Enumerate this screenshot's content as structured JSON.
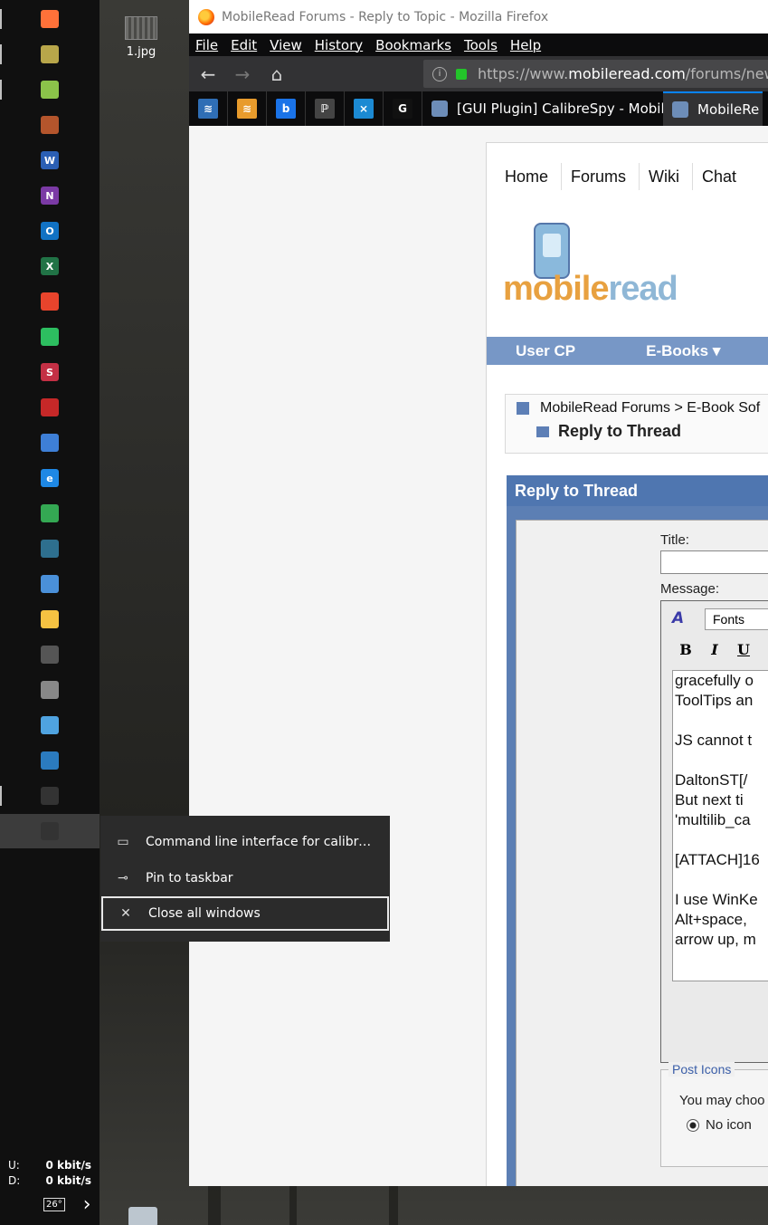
{
  "desktop": {
    "icon_label": "1.jpg"
  },
  "taskbar": {
    "apps": [
      {
        "name": "firefox",
        "color": "#ff7139"
      },
      {
        "name": "tool-app",
        "color": "#b8a64a"
      },
      {
        "name": "notes-app",
        "color": "#8bc34a"
      },
      {
        "name": "calibre-library",
        "color": "#b4552c"
      },
      {
        "name": "word",
        "letter": "W",
        "color": "#2b5fb4"
      },
      {
        "name": "onenote",
        "letter": "N",
        "color": "#7b3aa5"
      },
      {
        "name": "outlook",
        "letter": "O",
        "color": "#1172c4"
      },
      {
        "name": "excel",
        "letter": "X",
        "color": "#217346"
      },
      {
        "name": "pdf-app",
        "color": "#e8442c"
      },
      {
        "name": "evernote",
        "color": "#2dbe60"
      },
      {
        "name": "app-s",
        "letter": "S",
        "color": "#c43045"
      },
      {
        "name": "red-bug-app",
        "color": "#c62828"
      },
      {
        "name": "tool-app-2",
        "color": "#3e7fd6"
      },
      {
        "name": "edge",
        "letter": "e",
        "color": "#1e88e5"
      },
      {
        "name": "chrome",
        "color": "#34a853"
      },
      {
        "name": "editor-app",
        "color": "#2e6f8e"
      },
      {
        "name": "clipboard-app",
        "color": "#4a90d9"
      },
      {
        "name": "file-explorer",
        "color": "#f5c242"
      },
      {
        "name": "calculator",
        "color": "#555555"
      },
      {
        "name": "snip-tool",
        "color": "#888888"
      },
      {
        "name": "remote-app",
        "color": "#4fa3e0"
      },
      {
        "name": "app-blue",
        "color": "#2b7bbf"
      },
      {
        "name": "terminal",
        "color": "#333333"
      },
      {
        "name": "calibre-debug",
        "color": "#333333"
      }
    ],
    "network": {
      "up_label": "U:",
      "up_value": "0 kbit/s",
      "down_label": "D:",
      "down_value": "0 kbit/s"
    },
    "tray_temp": "26°",
    "tray_chevron": "›"
  },
  "jumplist": {
    "items": [
      {
        "label": "Command line interface for calibre d...",
        "icon": "▭"
      },
      {
        "label": "Pin to taskbar",
        "icon": "⊸"
      },
      {
        "label": "Close all windows",
        "icon": "✕"
      }
    ]
  },
  "browser": {
    "title": "MobileRead Forums - Reply to Topic - Mozilla Firefox",
    "menu": [
      "File",
      "Edit",
      "View",
      "History",
      "Bookmarks",
      "Tools",
      "Help"
    ],
    "url_prefix": "https://www.",
    "url_domain": "mobileread.com",
    "url_suffix": "/forums/new",
    "pinned_tabs": [
      {
        "name": "pinned-tab-1",
        "glyph": "≋",
        "color": "#2f6eb5"
      },
      {
        "name": "pinned-tab-2",
        "glyph": "≋",
        "color": "#e89b2c"
      },
      {
        "name": "pinned-tab-3",
        "glyph": "b",
        "color": "#1a73e8"
      },
      {
        "name": "pinned-tab-4",
        "glyph": "ℙ",
        "color": "#444444"
      },
      {
        "name": "pinned-tab-5",
        "glyph": "⨯",
        "color": "#1c8ad3"
      },
      {
        "name": "pinned-tab-6",
        "glyph": "G",
        "color": "#111111"
      }
    ],
    "tabs": [
      {
        "label": "[GUI Plugin] CalibreSpy - Mobil",
        "close": "✕"
      },
      {
        "label": "MobileRe"
      }
    ]
  },
  "page": {
    "nav": [
      "Home",
      "Forums",
      "Wiki",
      "Chat"
    ],
    "logo_text_a": "mobile",
    "logo_text_b": "read",
    "bluebar": [
      "User CP",
      "E-Books ▾"
    ],
    "breadcrumb_line1": "MobileRead Forums > E-Book Sof",
    "breadcrumb_line2": "Reply to Thread",
    "reply_header": "Reply to Thread",
    "title_label": "Title:",
    "message_label": "Message:",
    "font_select": "Fonts",
    "format_buttons": [
      "B",
      "I",
      "U"
    ],
    "message_lines": "gracefully o\nToolTips an\n\nJS cannot t\n\nDaltonST[/\nBut next ti\n'multilib_ca\n\n[ATTACH]16\n\nI use WinKe\nAlt+space, \narrow up, m",
    "post_icons_legend": "Post Icons",
    "post_icons_hint": "You may choo",
    "no_icon_label": "No icon"
  }
}
